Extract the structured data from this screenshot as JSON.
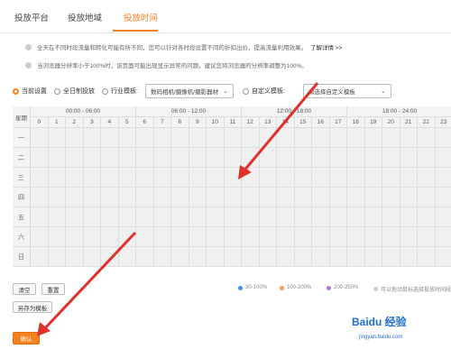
{
  "tabs": [
    {
      "label": "投放平台",
      "active": false
    },
    {
      "label": "投放地域",
      "active": false
    },
    {
      "label": "投放时间",
      "active": true
    }
  ],
  "notices": [
    {
      "text": "全天在不同时段流量和转化可能有所不同，您可以针对各时段设置不同的折扣出价，提高流量利用效果。",
      "link": "了解详情 >>"
    },
    {
      "text": "当浏览器分辨率小于100%时，该页面可能出现显示异常的问题，建议您将浏览器的分辨率调整为100%。",
      "link": ""
    }
  ],
  "options": {
    "current": "当前设置",
    "allday": "全日制投放",
    "industry": "行业模板:",
    "industry_value": "数码相机/摄像机/摄影器材",
    "custom": "自定义模板:",
    "custom_placeholder": "请选择自定义模板"
  },
  "grid": {
    "corner": "星期",
    "ranges": [
      "00:00 - 06:00",
      "06:00 - 12:00",
      "12:00 - 18:00",
      "18:00 - 24:00"
    ],
    "hours": [
      "0",
      "1",
      "2",
      "3",
      "4",
      "5",
      "6",
      "7",
      "8",
      "9",
      "10",
      "11",
      "12",
      "13",
      "14",
      "15",
      "16",
      "17",
      "18",
      "19",
      "20",
      "21",
      "22",
      "23"
    ],
    "days": [
      "一",
      "二",
      "三",
      "四",
      "五",
      "六",
      "日"
    ]
  },
  "buttons": {
    "clear": "清空",
    "reset": "重置",
    "save_template": "另存为模板",
    "confirm": "确认"
  },
  "legend": [
    {
      "label": "30-100%",
      "color": "#4a90e2"
    },
    {
      "label": "100-200%",
      "color": "#f5a05a"
    },
    {
      "label": "200-250%",
      "color": "#b07ad8"
    },
    {
      "label": "可以拖动鼠标选择投放时间段",
      "color": "#cccccc"
    }
  ],
  "watermark": {
    "brand": "Baidu 经验",
    "url": "jingyan.baidu.com"
  },
  "colors": {
    "accent": "#f5821f",
    "arrow": "#e0302a"
  }
}
